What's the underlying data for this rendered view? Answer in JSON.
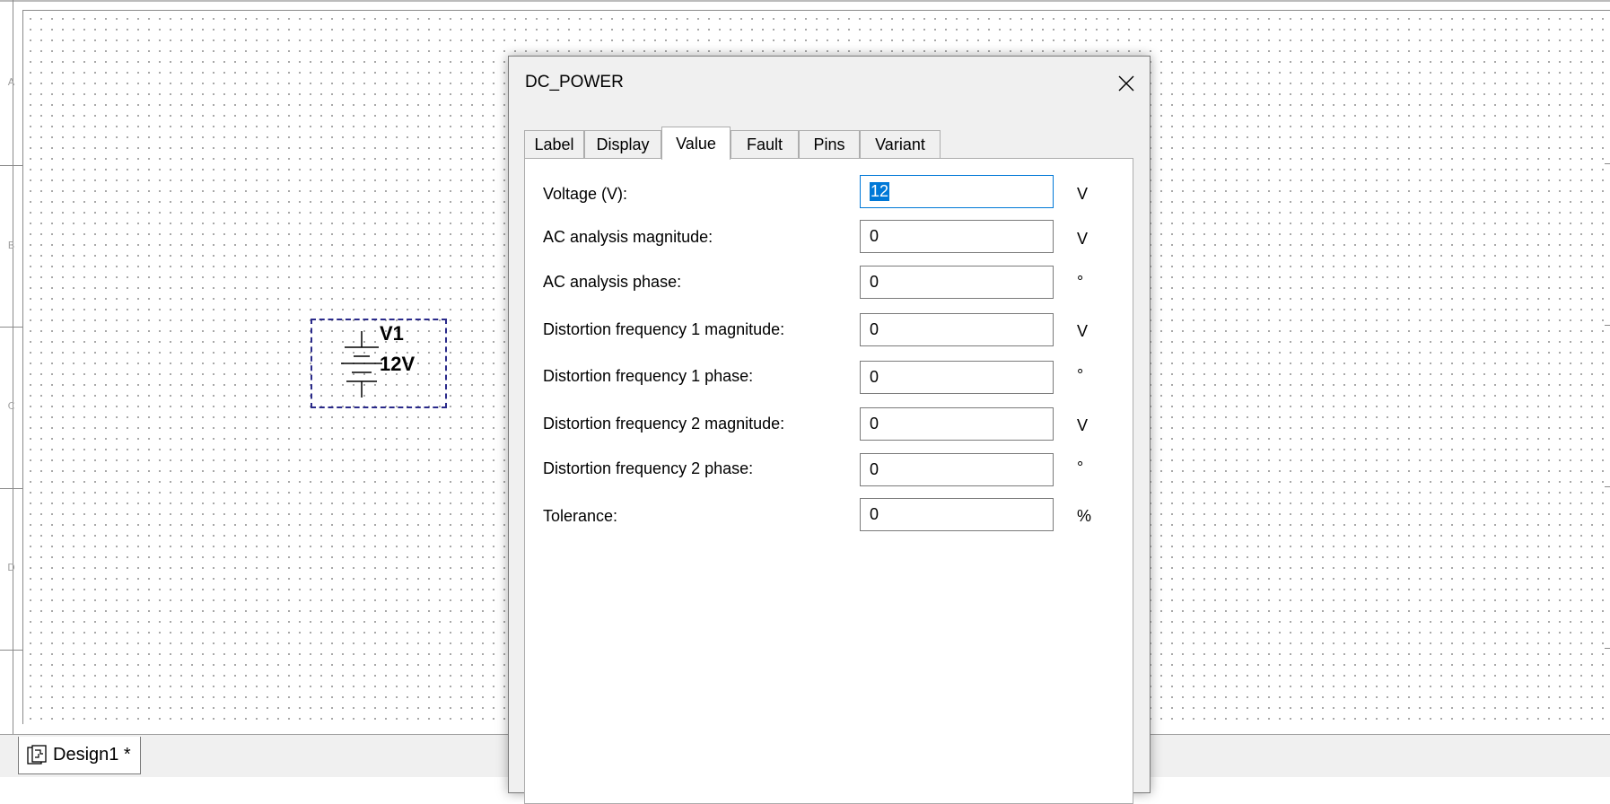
{
  "schematic": {
    "row_labels": [
      "A",
      "B",
      "C",
      "D"
    ],
    "component": {
      "ref": "V1",
      "value": "12V",
      "symbol": "dc-power-battery-icon"
    }
  },
  "bottom_tab": {
    "label": "Design1 *",
    "icon": "schematic-document-icon"
  },
  "dialog": {
    "title": "DC_POWER",
    "close_icon": "close-icon",
    "tabs": [
      {
        "label": "Label",
        "active": false
      },
      {
        "label": "Display",
        "active": false
      },
      {
        "label": "Value",
        "active": true
      },
      {
        "label": "Fault",
        "active": false
      },
      {
        "label": "Pins",
        "active": false
      },
      {
        "label": "Variant",
        "active": false
      }
    ],
    "fields": [
      {
        "label": "Voltage (V):",
        "value": "12",
        "unit": "V"
      },
      {
        "label": "AC analysis magnitude:",
        "value": "0",
        "unit": "V"
      },
      {
        "label": "AC analysis phase:",
        "value": "0",
        "unit": "°"
      },
      {
        "label": "Distortion frequency 1 magnitude:",
        "value": "0",
        "unit": "V"
      },
      {
        "label": "Distortion frequency 1 phase:",
        "value": "0",
        "unit": "°"
      },
      {
        "label": "Distortion frequency 2 magnitude:",
        "value": "0",
        "unit": "V"
      },
      {
        "label": "Distortion frequency 2 phase:",
        "value": "0",
        "unit": "°"
      },
      {
        "label": "Tolerance:",
        "value": "0",
        "unit": "%"
      }
    ]
  },
  "colors": {
    "selection": "#0078d7",
    "component_border": "#2a2a8a",
    "grid_dot": "#9a9a9a"
  }
}
